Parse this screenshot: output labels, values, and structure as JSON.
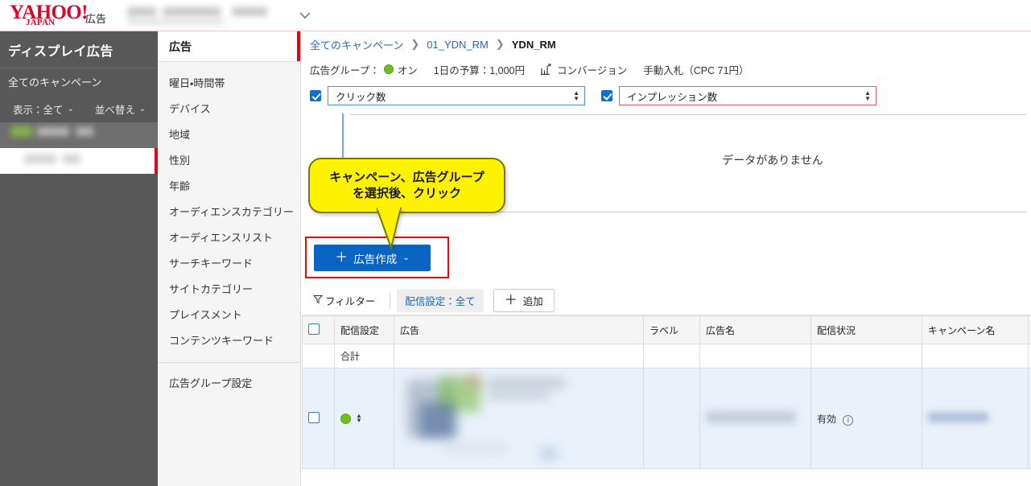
{
  "topbar": {
    "logo_word": "YAHOO!",
    "logo_sub": "JAPAN",
    "product": "広告",
    "account_masked": "",
    "caret": "chevron-down-icon"
  },
  "sidebar": {
    "title": "ディスプレイ広告",
    "all_campaigns": "全てのキャンペーン",
    "filter_display": "表示：全て",
    "filter_sort": "並べ替え",
    "rows": [
      {
        "masked": true,
        "selected": false
      },
      {
        "masked": true,
        "selected": true
      }
    ]
  },
  "subnav": {
    "active": "広告",
    "items": [
      {
        "label": "曜日・時間帯"
      },
      {
        "label": "デバイス"
      },
      {
        "label": "地域"
      },
      {
        "label": "性別"
      },
      {
        "label": "年齢"
      },
      {
        "label": "オーディエンスカテゴリー"
      },
      {
        "label": "オーディエンスリスト"
      },
      {
        "label": "サーチキーワード"
      },
      {
        "label": "サイトカテゴリー"
      },
      {
        "label": "プレイスメント"
      },
      {
        "label": "コンテンツキーワード"
      }
    ],
    "settings_item": "広告グループ設定"
  },
  "breadcrumb": {
    "items": [
      "全てのキャンペーン",
      "01_YDN_RM",
      "YDN_RM"
    ],
    "separator": "❯"
  },
  "meta": {
    "group_label": "広告グループ：",
    "status": "オン",
    "budget": "1日の予算：1,000円",
    "conversion": "コンバージョン",
    "bid": "手動入札（CPC 71円）"
  },
  "metric_selects": [
    {
      "checked": true,
      "value": "クリック数",
      "accent": "#4a90d9"
    },
    {
      "checked": true,
      "value": "インプレッション数",
      "accent": "#e8556f"
    }
  ],
  "chart_data": {
    "type": "line",
    "title": "",
    "empty_message": "データがありません",
    "series": [
      {
        "name": "クリック数",
        "values": [],
        "color": "#4a90d9"
      },
      {
        "name": "インプレッション数",
        "values": [],
        "color": "#e8556f"
      }
    ],
    "x": [],
    "xlabel": "",
    "ylabel": "",
    "grid": true,
    "gridlines": 2,
    "legend": "top"
  },
  "callout": {
    "line1": "キャンペーン、広告グループ",
    "line2": "を選択後、クリック",
    "background": "#fff200",
    "text_color": "#1a1a1a"
  },
  "create_button": {
    "plus": "＋",
    "label": "広告作成",
    "caret": "chevron-down-icon",
    "color": "#0a65c2",
    "highlight_color": "#ff0000"
  },
  "toolbar": {
    "filter": "フィルター",
    "chip": "配信設定：全て",
    "add_plus": "＋",
    "add": "追加"
  },
  "table": {
    "headers": [
      "",
      "配信設定",
      "広告",
      "ラベル",
      "広告名",
      "配信状況",
      "キャンペーン名",
      ""
    ],
    "total_row_label": "合計",
    "rows": [
      {
        "checked": false,
        "delivery_status": "on",
        "creative": "",
        "label": "",
        "ad_name": "",
        "status": "有効",
        "status_info": "ⓘ",
        "campaign_name": ""
      }
    ]
  }
}
